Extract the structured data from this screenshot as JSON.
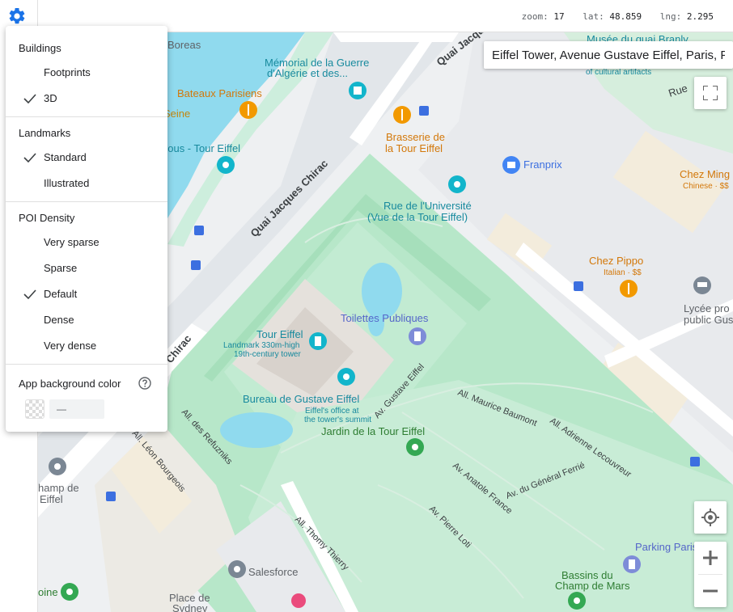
{
  "status": {
    "zoom_label": "zoom:",
    "zoom_value": "17",
    "lat_label": "lat:",
    "lat_value": "48.859",
    "lng_label": "lng:",
    "lng_value": "2.295"
  },
  "search": {
    "value": "Eiffel Tower, Avenue Gustave Eiffel, Paris, France"
  },
  "menu": {
    "buildings": {
      "title": "Buildings",
      "options": [
        {
          "label": "Footprints",
          "checked": false
        },
        {
          "label": "3D",
          "checked": true
        }
      ]
    },
    "landmarks": {
      "title": "Landmarks",
      "options": [
        {
          "label": "Standard",
          "checked": true
        },
        {
          "label": "Illustrated",
          "checked": false
        }
      ]
    },
    "poi_density": {
      "title": "POI Density",
      "options": [
        {
          "label": "Very sparse",
          "checked": false
        },
        {
          "label": "Sparse",
          "checked": false
        },
        {
          "label": "Default",
          "checked": true
        },
        {
          "label": "Dense",
          "checked": false
        },
        {
          "label": "Very dense",
          "checked": false
        }
      ]
    },
    "background": {
      "title": "App background color",
      "value": "—"
    }
  },
  "map": {
    "labels": {
      "boreas": "Boreas",
      "memorial_1": "Mémorial de la Guerre",
      "memorial_2": "d'Algérie et des...",
      "musee": "Musée du quai Branly",
      "cultural": "of cultural artifacts",
      "bateaux": "Bateaux Parisiens",
      "seine": "Seine",
      "quai_1": "Quai Jacques",
      "rue": "Rue",
      "brasserie_1": "Brasserie de",
      "brasserie_2": "la Tour Eiffel",
      "franprix": "Franprix",
      "chezming": "Chez Ming",
      "chinese": "Chinese · $$",
      "bous": "bous - Tour Eiffel",
      "quai_chirac": "Quai Jacques Chirac",
      "rue_univ_1": "Rue de l'Université",
      "rue_univ_2": "(Vue de la Tour Eiffel)",
      "chezpippo": "Chez Pippo",
      "italian": "Italian · $$",
      "lycee_1": "Lycée pro",
      "lycee_2": "public Gus",
      "chirac": "Chirac",
      "toilettes": "Toilettes Publiques",
      "tour_eiffel": "Tour Eiffel",
      "landmark_1": "Landmark 330m-high",
      "landmark_2": "19th-century tower",
      "bureau": "Bureau de Gustave Eiffel",
      "office_1": "Eiffel's office at",
      "office_2": "the tower's summit",
      "av_gustave": "Av. Gustave Eiffel",
      "all_baumont": "All. Maurice Baumont",
      "all_lecouvreur": "All. Adrienne Lecouvreur",
      "jardin": "Jardin de la Tour Eiffel",
      "all_refuzniks": "All. des Refuzniks",
      "leon_bourgeois": "All. Léon Bourgeois",
      "champ_1": "hamp de",
      "champ_2": "Eiffel",
      "av_france": "Av. Anatole France",
      "av_ferrie": "Av. du Général Ferrié",
      "av_loti": "Av. Pierre Loti",
      "all_thierry": "All. Thomy Thierry",
      "parking": "Parking Paris Au",
      "salesforce": "Salesforce",
      "bassins_1": "Bassins du",
      "bassins_2": "Champ de Mars",
      "place_1": "Place de",
      "place_2": "Sydney",
      "oine": "oine"
    }
  }
}
